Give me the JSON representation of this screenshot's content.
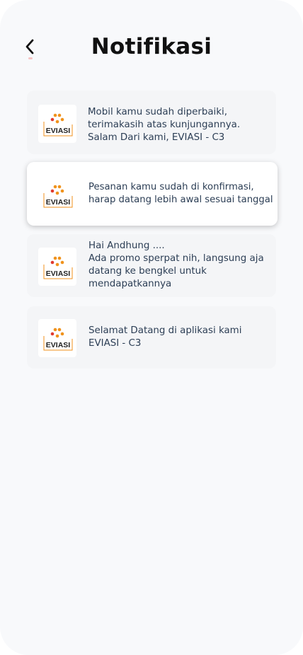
{
  "header": {
    "title": "Notifikasi"
  },
  "logo_text": "EVIASI",
  "colors": {
    "background": "#f8f9fb",
    "card": "#f4f5f7",
    "card_active": "#ffffff",
    "text": "#2c3e55",
    "logo_orange": "#f0921c",
    "logo_red": "#e03a2f"
  },
  "notifications": [
    {
      "message": "Mobil kamu sudah diperbaiki,\nterimakasih atas kunjungannya.\nSalam Dari kami, EVIASI - C3",
      "active": false
    },
    {
      "message": "Pesanan kamu sudah di konfirmasi,\nharap datang lebih awal sesuai tanggal",
      "active": true
    },
    {
      "message": "Hai Andhung ....\nAda promo sperpat nih, langsung aja\ndatang ke bengkel untuk\nmendapatkannya",
      "active": false
    },
    {
      "message": "Selamat Datang di aplikasi kami\nEVIASI - C3",
      "active": false
    }
  ]
}
